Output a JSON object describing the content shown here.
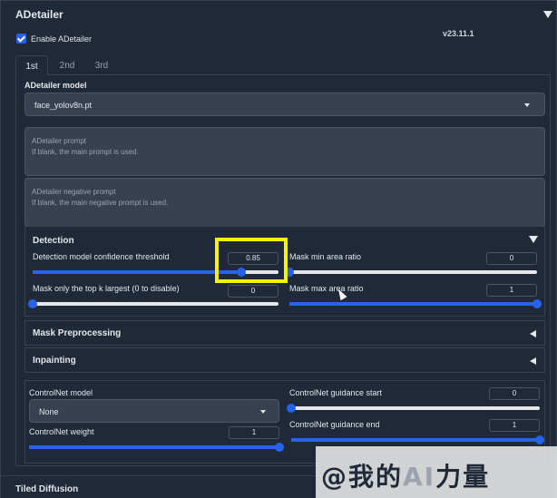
{
  "header": {
    "title": "ADetailer"
  },
  "enable": {
    "label": "Enable ADetailer",
    "checked": true
  },
  "version": "v23.11.1",
  "tabs": [
    {
      "label": "1st"
    },
    {
      "label": "2nd"
    },
    {
      "label": "3rd"
    }
  ],
  "model": {
    "label": "ADetailer model",
    "value": "face_yolov8n.pt"
  },
  "prompt": {
    "label": "ADetailer prompt",
    "placeholder": "If blank, the main prompt is used."
  },
  "negative_prompt": {
    "label": "ADetailer negative prompt",
    "placeholder": "If blank, the main negative prompt is used."
  },
  "detection": {
    "title": "Detection",
    "confidence": {
      "label": "Detection model confidence threshold",
      "value": "0.85",
      "fraction": 0.85
    },
    "min_area": {
      "label": "Mask min area ratio",
      "value": "0",
      "fraction": 0
    },
    "top_k": {
      "label": "Mask only the top k largest (0 to disable)",
      "value": "0",
      "fraction": 0
    },
    "max_area": {
      "label": "Mask max area ratio",
      "value": "1",
      "fraction": 1
    }
  },
  "mask_preprocessing": {
    "title": "Mask Preprocessing"
  },
  "inpainting": {
    "title": "Inpainting"
  },
  "controlnet": {
    "model": {
      "label": "ControlNet model",
      "value": "None"
    },
    "weight": {
      "label": "ControlNet weight",
      "value": "1",
      "fraction": 1
    },
    "guidance_start": {
      "label": "ControlNet guidance start",
      "value": "0",
      "fraction": 0
    },
    "guidance_end": {
      "label": "ControlNet guidance end",
      "value": "1",
      "fraction": 1
    }
  },
  "watermark": {
    "prefix": "@我的",
    "ai": "AI",
    "suffix": "力量"
  },
  "tiled_diffusion": {
    "title": "Tiled Diffusion"
  },
  "colors": {
    "accent": "#2563eb",
    "highlight": "#f8f20a",
    "panel": "#1f2937"
  }
}
